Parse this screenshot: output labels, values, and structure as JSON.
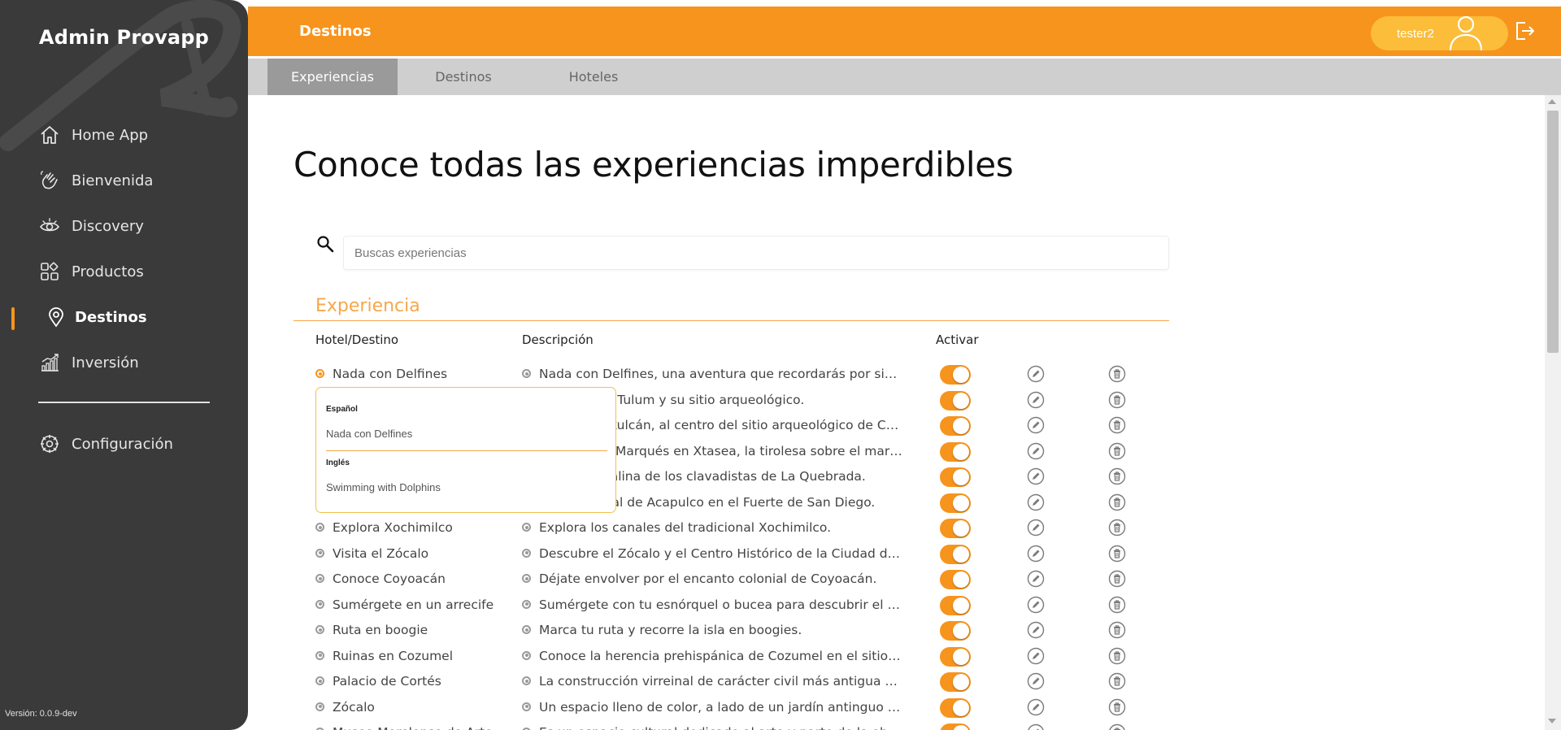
{
  "app": {
    "brand": "Admin Provapp",
    "version": "Versión: 0.0.9-dev"
  },
  "sidebar": {
    "items": [
      {
        "label": "Home App",
        "icon": "home-icon"
      },
      {
        "label": "Bienvenida",
        "icon": "wave-hand-icon"
      },
      {
        "label": "Discovery",
        "icon": "eye-icon"
      },
      {
        "label": "Productos",
        "icon": "grid-icon"
      },
      {
        "label": "Destinos",
        "icon": "location-pin-icon",
        "active": true
      },
      {
        "label": "Inversión",
        "icon": "bar-chart-icon"
      }
    ],
    "config": {
      "label": "Configuración",
      "icon": "gear-icon"
    }
  },
  "header": {
    "title": "Destinos",
    "user": "tester2"
  },
  "tabs": [
    {
      "label": "Experiencias",
      "active": true
    },
    {
      "label": "Destinos",
      "active": false
    },
    {
      "label": "Hoteles",
      "active": false
    }
  ],
  "main": {
    "heading": "Conoce todas las experiencias imperdibles",
    "search_placeholder": "Buscas experiencias",
    "section_title": "Experiencia",
    "columns": {
      "name": "Hotel/Destino",
      "desc": "Descripción",
      "active": "Activar"
    }
  },
  "rows": [
    {
      "name": "Nada con Delfines",
      "desc": "Nada con Delfines, una aventura que recordarás por siempre."
    },
    {
      "name": "",
      "desc": "ue Nacional Tulum y su sitio arqueológico."
    },
    {
      "name": "",
      "desc": "mplo de Kukulcán, al centro del sitio arqueológico de Chichén Itzá."
    },
    {
      "name": "",
      "desc": "a de Puerto Marqués en Xtasea, la tirolesa sobre el mar más larga del mundo."
    },
    {
      "name": "",
      "desc": "on la adrenalina de los clavadistas de La Quebrada."
    },
    {
      "name": "",
      "desc": "gado colonial de Acapulco en el Fuerte de San Diego."
    },
    {
      "name": "Explora Xochimilco",
      "desc": "Explora los canales del tradicional Xochimilco."
    },
    {
      "name": "Visita el Zócalo",
      "desc": "Descubre el Zócalo y el Centro Histórico de la Ciudad de México."
    },
    {
      "name": "Conoce Coyoacán",
      "desc": "Déjate envolver por el encanto colonial de Coyoacán."
    },
    {
      "name": "Sumérgete en un arrecife",
      "desc": "Sumérgete con tu esnórquel o bucea para descubrir el hermoso arrecife."
    },
    {
      "name": "Ruta en boogie",
      "desc": "Marca tu ruta y recorre la isla en boogies."
    },
    {
      "name": "Ruinas en Cozumel",
      "desc": "Conoce la herencia prehispánica de Cozumel en el sitio arqueológico."
    },
    {
      "name": "Palacio de Cortés",
      "desc": "La construcción virreinal de carácter civil más antigua de México."
    },
    {
      "name": "Zócalo",
      "desc": "Un espacio lleno de color, a lado de un jardín antinguo que dio origen a la ciudad."
    },
    {
      "name": "Museo Morelense de Arte",
      "desc": "Es un espacio cultural dedicado al arte y parte de la obra."
    }
  ],
  "popover": {
    "lang1": "Español",
    "text1": "Nada con Delfines",
    "lang2": "Inglés",
    "text2": "Swimming with Dolphins"
  },
  "colors": {
    "accent": "#f7941d",
    "sidebar": "#3a3a3a",
    "tabbar": "#cfcfcf",
    "tab_active": "#9a9a9a"
  }
}
